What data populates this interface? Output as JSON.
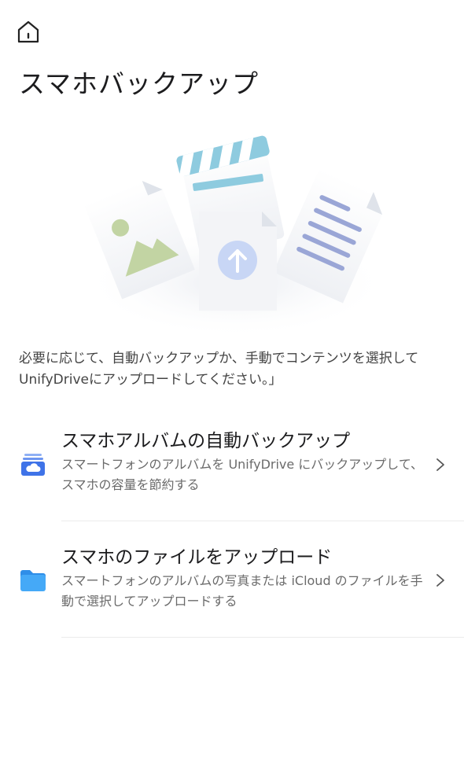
{
  "header": {
    "home_icon": "home-icon",
    "title": "スマホバックアップ"
  },
  "hero": {
    "illustration": "backup-files-illustration"
  },
  "description": "必要に応じて、自動バックアップか、手動でコンテンツを選択して UnifyDriveにアップロードしてください。」",
  "options": [
    {
      "icon": "cloud-album-icon",
      "title": "スマホアルバムの自動バックアップ",
      "description": "スマートフォンのアルバムを UnifyDrive にバックアップして、スマホの容量を節約する",
      "chevron": "chevron-right-icon"
    },
    {
      "icon": "folder-icon",
      "title": "スマホのファイルをアップロード",
      "description": "スマートフォンのアルバムの写真または iCloud のファイルを手動で選択してアップロードする",
      "chevron": "chevron-right-icon"
    }
  ],
  "colors": {
    "accent_blue": "#3f73e8",
    "folder_blue": "#3aa0f5",
    "title_text": "#1c1c1e",
    "secondary_text": "#6b6b6b"
  }
}
